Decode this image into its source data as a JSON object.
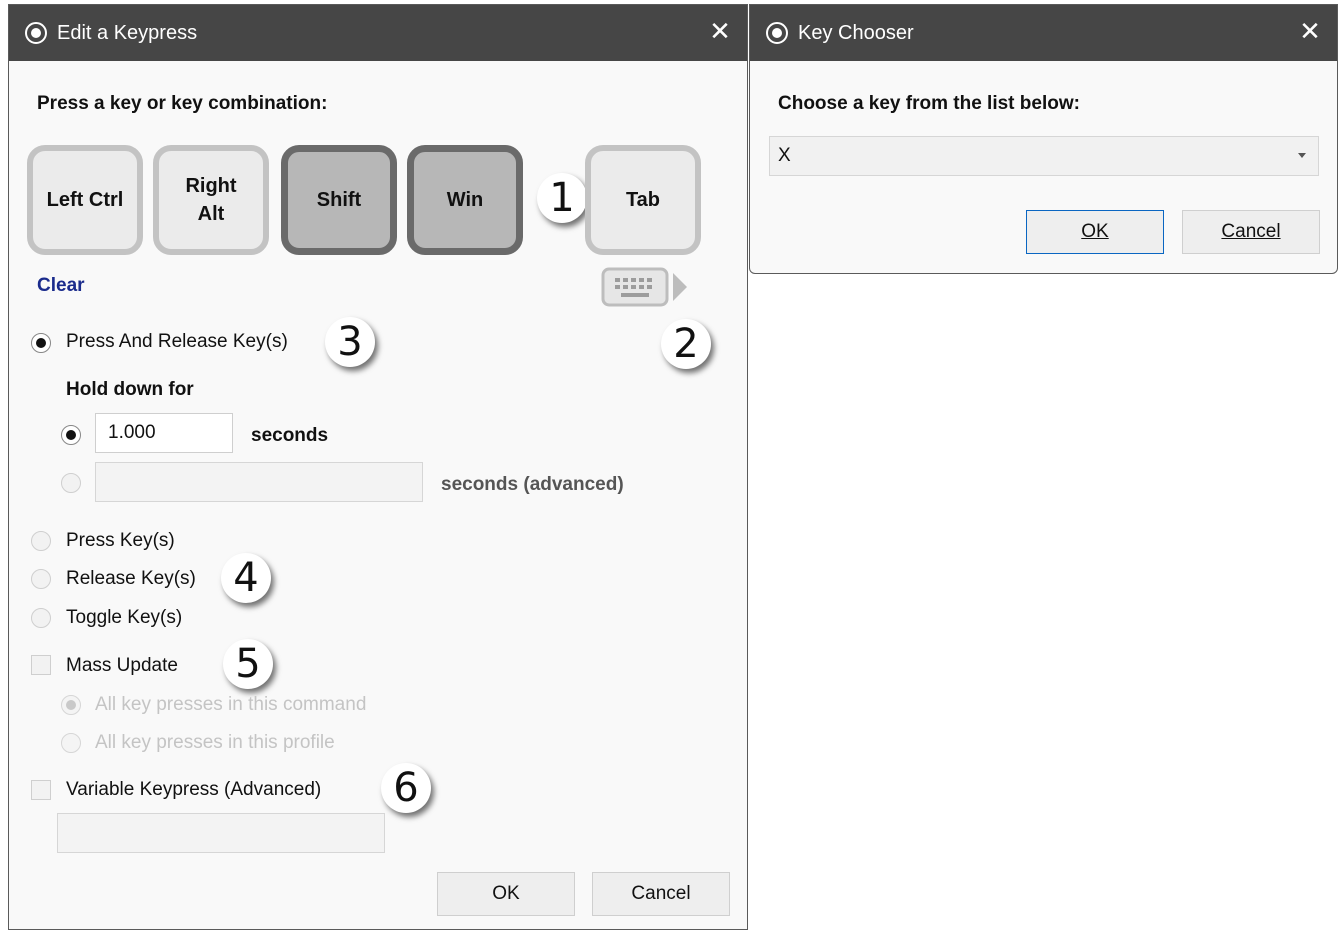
{
  "edit_dialog": {
    "title": "Edit a Keypress",
    "close_glyph": "✕",
    "prompt": "Press a key or key combination:",
    "keys": [
      {
        "label": "Left Ctrl",
        "state": "inactive"
      },
      {
        "label": "Right Alt",
        "state": "inactive"
      },
      {
        "label": "Shift",
        "state": "active"
      },
      {
        "label": "Win",
        "state": "active"
      },
      {
        "label": "Tab",
        "state": "inactive"
      }
    ],
    "clear_label": "Clear",
    "keyboard_icon": "keyboard-icon",
    "press_release_label": "Press And Release Key(s)",
    "hold_down_label": "Hold down for",
    "hold_seconds_value": "1.000",
    "seconds_label": "seconds",
    "advanced_seconds_value": "",
    "seconds_advanced_label": "seconds (advanced)",
    "press_keys_label": "Press Key(s)",
    "release_keys_label": "Release Key(s)",
    "toggle_keys_label": "Toggle Key(s)",
    "mass_update_label": "Mass Update",
    "all_command_label": "All key presses in this command",
    "all_profile_label": "All key presses in this profile",
    "variable_keypress_label": "Variable Keypress (Advanced)",
    "variable_keypress_value": "",
    "ok_label": "OK",
    "cancel_label": "Cancel",
    "selected_mode": "Press And Release Key(s)"
  },
  "key_chooser": {
    "title": "Key Chooser",
    "close_glyph": "✕",
    "prompt": "Choose a key from the list below:",
    "selected_key": "X",
    "ok_label": "OK",
    "cancel_label": "Cancel"
  },
  "callouts": [
    "1",
    "2",
    "3",
    "4",
    "5",
    "6"
  ],
  "colors": {
    "titlebar": "#464646",
    "link": "#1a2b8c",
    "primary_border": "#0a66c2"
  }
}
